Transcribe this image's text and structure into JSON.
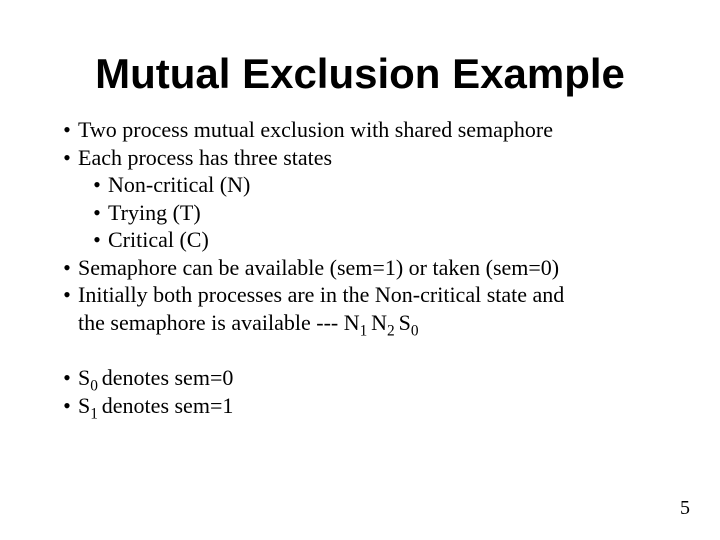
{
  "title": "Mutual Exclusion Example",
  "bullets": {
    "b1": "Two process mutual exclusion with shared semaphore",
    "b2": "Each process has three states",
    "b2a": "Non-critical (N)",
    "b2b": "Trying (T)",
    "b2c": "Critical (C)",
    "b3": "Semaphore can be available (sem=1) or taken (sem=0)",
    "b4a": "Initially both processes are in the Non-critical state and",
    "b4b_prefix": "the semaphore is available --- N",
    "b4b_s1": "1 ",
    "b4b_mid1": "N",
    "b4b_s2": "2 ",
    "b4b_mid2": "S",
    "b4b_s3": "0",
    "c1_pre": " S",
    "c1_sub": "0 ",
    "c1_post": "denotes sem=0",
    "c2_pre": " S",
    "c2_sub": "1 ",
    "c2_post": "denotes sem=1"
  },
  "page": "5"
}
